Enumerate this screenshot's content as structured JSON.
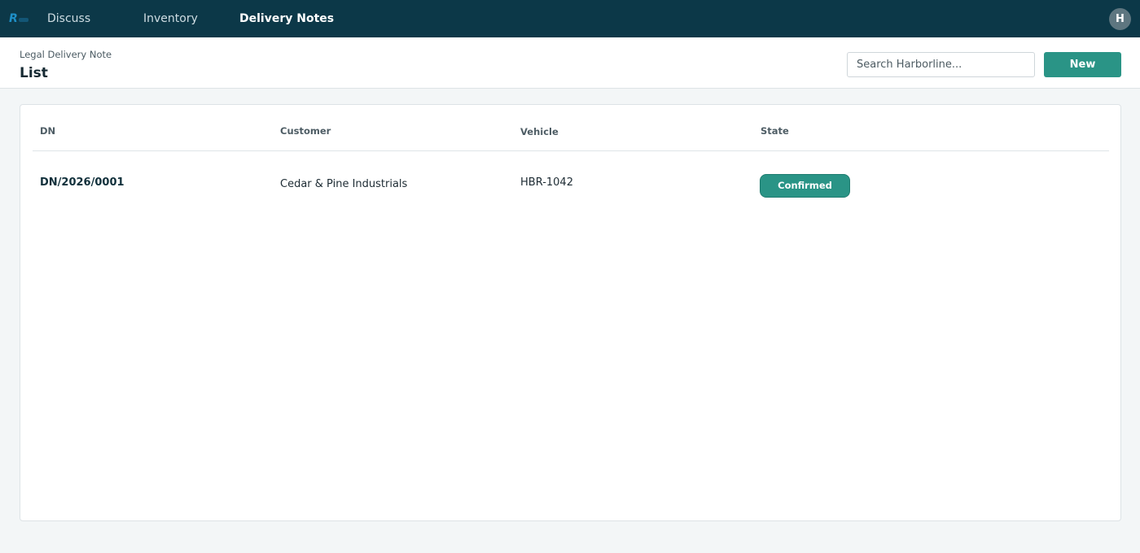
{
  "app": {
    "nav": [
      {
        "label": "Discuss",
        "active": false
      },
      {
        "label": "Inventory",
        "active": false
      },
      {
        "label": "Delivery Notes",
        "active": true
      }
    ],
    "user_initial": "H",
    "logo_icon": "app-logo-icon"
  },
  "header": {
    "breadcrumb": "Legal Delivery Note",
    "title": "List",
    "search_placeholder": "Search Harborline...",
    "new_label": "New"
  },
  "table": {
    "columns": [
      "DN",
      "Customer",
      "Vehicle",
      "State"
    ],
    "rows": [
      {
        "dn": "DN/2026/0001",
        "customer": "Cedar & Pine Industrials",
        "vehicle": "HBR-1042",
        "state": "Confirmed"
      }
    ]
  },
  "colors": {
    "topbar": "#0c3848",
    "accent": "#2a9486",
    "background": "#f3f6f7"
  }
}
